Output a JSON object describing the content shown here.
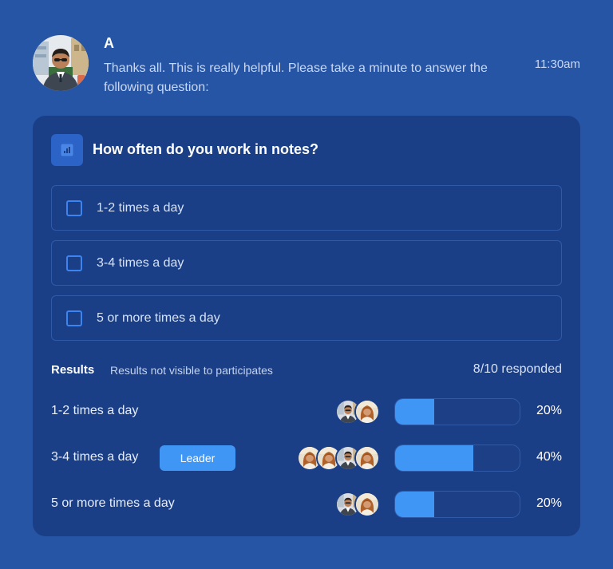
{
  "message": {
    "sender": "A",
    "text": "Thanks all. This is really helpful. Please take a minute to answer the following question:",
    "time": "11:30am",
    "avatar": "man-in-suit-avatar"
  },
  "poll": {
    "icon": "bar-chart-icon",
    "question": "How often do you work in notes?",
    "options": [
      {
        "label": "1-2 times a day"
      },
      {
        "label": "3-4 times a day"
      },
      {
        "label": "5 or more times a day"
      }
    ]
  },
  "results": {
    "title": "Results",
    "note": "Results not visible to participates",
    "responded": "8/10 responded",
    "rows": [
      {
        "label": "1-2 times a day",
        "percent": "20%",
        "fraction": 0.2,
        "voters": [
          "man-avatar",
          "woman-avatar"
        ]
      },
      {
        "label": "3-4 times a day",
        "percent": "40%",
        "fraction": 0.4,
        "badge": "Leader",
        "voters": [
          "woman-avatar",
          "woman-avatar",
          "man-avatar",
          "woman-avatar"
        ]
      },
      {
        "label": "5 or more times a day",
        "percent": "20%",
        "fraction": 0.2,
        "voters": [
          "man-avatar",
          "woman-avatar"
        ]
      }
    ]
  },
  "colors": {
    "background": "#2555a4",
    "card": "#1b3f86",
    "accent": "#4096f5"
  }
}
